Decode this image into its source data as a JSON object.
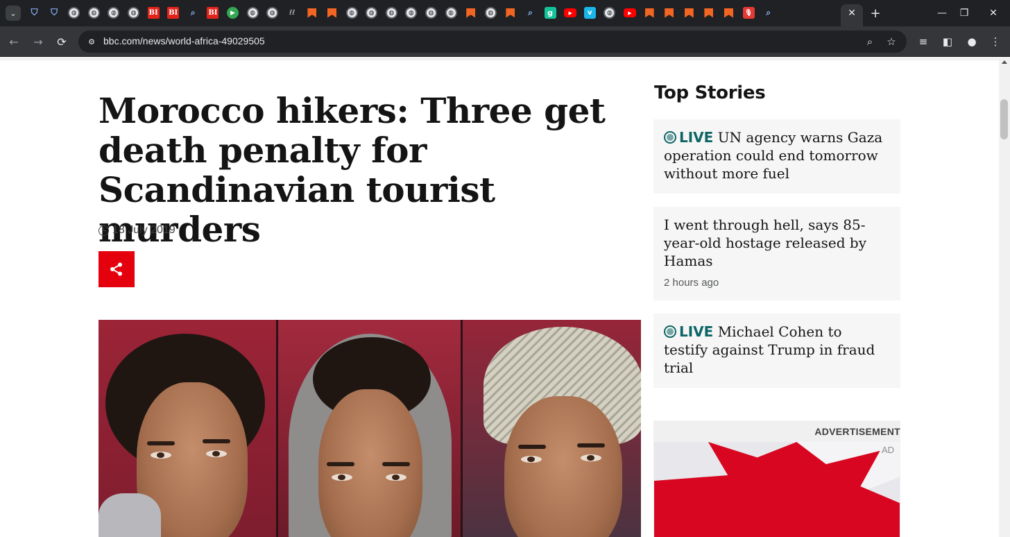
{
  "browser": {
    "tab_favicons": [
      "shield",
      "shield",
      "globe",
      "globe",
      "globe",
      "globe",
      "bi",
      "bi",
      "search",
      "bi",
      "play",
      "globe",
      "globe",
      "li",
      "bm",
      "bm",
      "globe",
      "globe",
      "globe",
      "globe",
      "globe",
      "globe",
      "bm",
      "globe",
      "bm",
      "search",
      "g",
      "yt",
      "v",
      "globe",
      "yt",
      "bm",
      "bm",
      "bm",
      "bm",
      "bm",
      "pod",
      "search"
    ],
    "favicon_glyphs": {
      "bi": "BI",
      "play": "▶",
      "li": "ℓℓ",
      "g": "g",
      "yt": "▶",
      "v": "v",
      "pod": "🎙",
      "shield": "⛉",
      "search": "⌕",
      "globe": "◍"
    },
    "active_tab_close": "✕",
    "new_tab": "+",
    "tab_search_icon": "⌄",
    "window_controls": {
      "minimize": "—",
      "restore": "❐",
      "close": "✕"
    },
    "nav": {
      "back": "←",
      "forward": "→",
      "reload": "⟳"
    },
    "url": "bbc.com/news/world-africa-49029505",
    "toolbar_icons": {
      "site_info": "⚙",
      "zoom": "⌕",
      "bookmark": "☆",
      "media": "≡",
      "side_panel": "◧",
      "profile": "●",
      "menu": "⋮"
    }
  },
  "article": {
    "headline": "Morocco hikers: Three get death penalty for Scandinavian tourist murders",
    "date": "18 July 2019",
    "share_icon": "share-icon"
  },
  "sidebar": {
    "heading": "Top Stories",
    "stories": [
      {
        "live_label": "LIVE",
        "title": "UN agency warns Gaza operation could end tomorrow without more fuel"
      },
      {
        "title": "I went through hell, says 85-year-old hostage released by Hamas",
        "time": "2 hours ago"
      },
      {
        "live_label": "LIVE",
        "title": "Michael Cohen to testify against Trump in fraud trial"
      }
    ],
    "advertisement_label": "ADVERTISEMENT",
    "ad_tag": "AD"
  },
  "colors": {
    "share_red": "#e5000e",
    "live_teal": "#0e6565",
    "chrome_dark": "#202124"
  }
}
